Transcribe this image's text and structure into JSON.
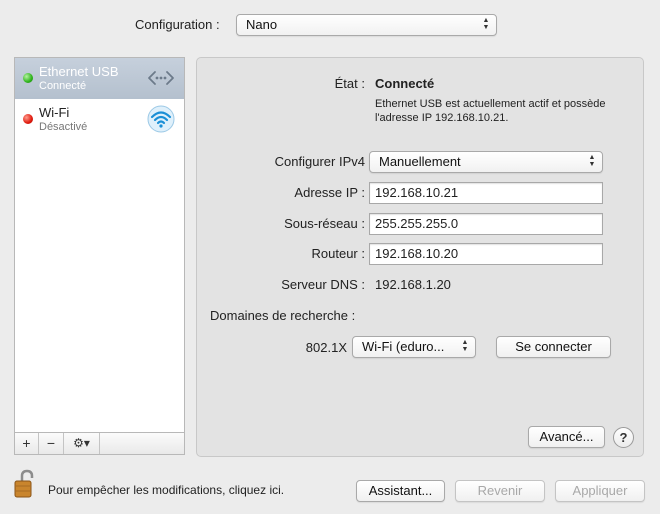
{
  "configuration": {
    "label": "Configuration :",
    "value": "Nano"
  },
  "sidebar": {
    "services": [
      {
        "name": "Ethernet USB",
        "status": "Connecté",
        "status_color": "#2db31a",
        "icon": "ethernet-icon",
        "selected": true
      },
      {
        "name": "Wi-Fi",
        "status": "Désactivé",
        "status_color": "#e01a0d",
        "icon": "wifi-icon",
        "selected": false
      }
    ],
    "buttons": {
      "add": "+",
      "remove": "−",
      "action": "⚙▾"
    }
  },
  "detail": {
    "status_label": "État :",
    "status_value": "Connecté",
    "status_description": "Ethernet USB est actuellement actif et possède l'adresse IP 192.168.10.21.",
    "ipv4_label": "Configurer IPv4",
    "ipv4_value": "Manuellement",
    "ip_label": "Adresse IP :",
    "ip_value": "192.168.10.21",
    "subnet_label": "Sous-réseau :",
    "subnet_value": "255.255.255.0",
    "router_label": "Routeur :",
    "router_value": "192.168.10.20",
    "dns_label": "Serveur DNS :",
    "dns_value": "192.168.1.20",
    "search_domains_label": "Domaines de recherche :",
    "dot1x_label": "802.1X",
    "dot1x_value": "Wi-Fi (eduro...",
    "connect_button": "Se connecter",
    "advanced_button": "Avancé...",
    "help_button": "?"
  },
  "footer": {
    "lock_text": "Pour empêcher les modifications, cliquez ici.",
    "assistant_button": "Assistant...",
    "revert_button": "Revenir",
    "apply_button": "Appliquer"
  },
  "colors": {
    "selection": "#b4c0ce",
    "panel": "#e3e3e3",
    "background": "#ececec"
  }
}
